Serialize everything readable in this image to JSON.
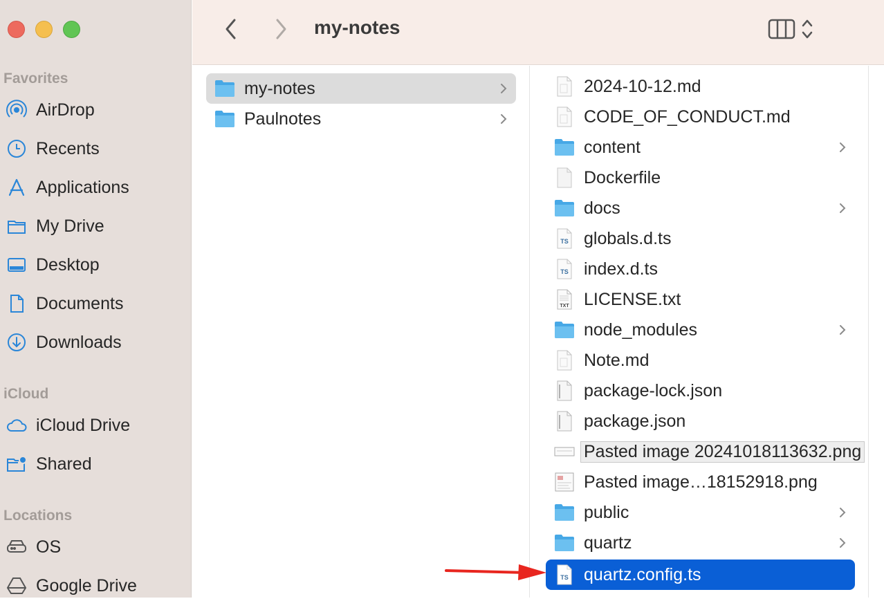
{
  "window": {
    "title": "my-notes"
  },
  "sidebar": {
    "sections": [
      {
        "heading": "Favorites",
        "items": [
          {
            "label": "AirDrop",
            "icon": "airdrop-icon"
          },
          {
            "label": "Recents",
            "icon": "clock-icon"
          },
          {
            "label": "Applications",
            "icon": "applications-icon"
          },
          {
            "label": "My Drive",
            "icon": "folder-icon"
          },
          {
            "label": "Desktop",
            "icon": "desktop-icon"
          },
          {
            "label": "Documents",
            "icon": "document-icon"
          },
          {
            "label": "Downloads",
            "icon": "download-icon"
          }
        ]
      },
      {
        "heading": "iCloud",
        "items": [
          {
            "label": "iCloud Drive",
            "icon": "cloud-icon"
          },
          {
            "label": "Shared",
            "icon": "shared-folder-icon"
          }
        ]
      },
      {
        "heading": "Locations",
        "items": [
          {
            "label": "OS",
            "icon": "disk-icon"
          },
          {
            "label": "Google Drive",
            "icon": "google-drive-icon"
          }
        ]
      }
    ]
  },
  "column1": {
    "items": [
      {
        "name": "my-notes",
        "type": "folder",
        "selected": true
      },
      {
        "name": "Paulnotes",
        "type": "folder"
      }
    ]
  },
  "column2": {
    "items": [
      {
        "name": "2024-10-12.md",
        "type": "doc"
      },
      {
        "name": "CODE_OF_CONDUCT.md",
        "type": "doc"
      },
      {
        "name": "content",
        "type": "folder"
      },
      {
        "name": "Dockerfile",
        "type": "blank"
      },
      {
        "name": "docs",
        "type": "folder"
      },
      {
        "name": "globals.d.ts",
        "type": "ts"
      },
      {
        "name": "index.d.ts",
        "type": "ts"
      },
      {
        "name": "LICENSE.txt",
        "type": "txt"
      },
      {
        "name": "node_modules",
        "type": "folder"
      },
      {
        "name": "Note.md",
        "type": "doc"
      },
      {
        "name": "package-lock.json",
        "type": "json"
      },
      {
        "name": "package.json",
        "type": "json"
      },
      {
        "name": "Pasted image 20241018113632.png",
        "type": "image-wide"
      },
      {
        "name": "Pasted image…18152918.png",
        "type": "image"
      },
      {
        "name": "public",
        "type": "folder"
      },
      {
        "name": "quartz",
        "type": "folder"
      },
      {
        "name": "quartz.config.ts",
        "type": "ts",
        "selected": true
      }
    ]
  },
  "colors": {
    "accent": "#0a5fd6",
    "folder": "#47a8e6",
    "arrow": "#e8261f"
  }
}
